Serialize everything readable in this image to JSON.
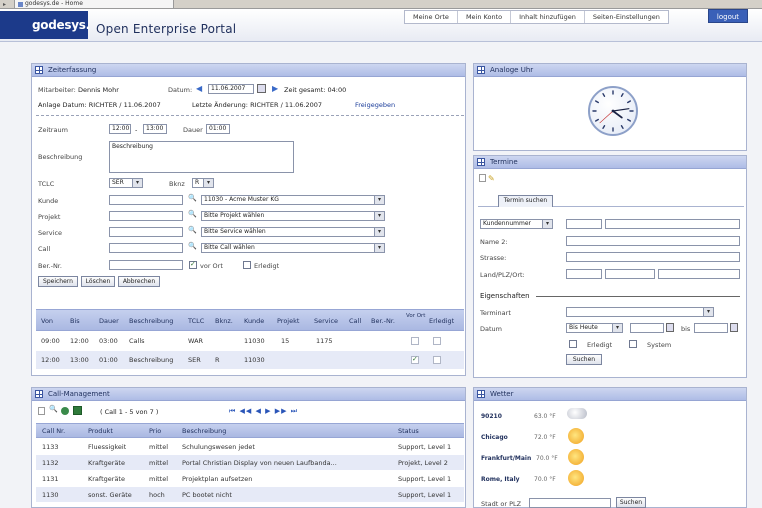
{
  "browser": {
    "tab_title": "godesys.de - Home"
  },
  "header": {
    "logo": "godesys.",
    "title": "Open Enterprise Portal",
    "nav": [
      "Meine Orte",
      "Mein Konto",
      "Inhalt hinzufügen",
      "Seiten-Einstellungen"
    ],
    "logout": "logout"
  },
  "zeit": {
    "title": "Zeiterfassung",
    "mitarbeiter_label": "Mitarbeiter:",
    "mitarbeiter": "Dennis Mohr",
    "datum_label": "Datum:",
    "datum": "11.06.2007",
    "zeit_gesamt": "Zeit gesamt: 04:00",
    "anlage": "Anlage Datum: RICHTER / 11.06.2007",
    "aenderung": "Letzte Änderung: RICHTER / 11.06.2007",
    "freigegeben": "Freigegeben",
    "zeitraum_label": "Zeitraum",
    "von": "12:00",
    "dash": "-",
    "bis": "13:00",
    "dauer_label": "Dauer",
    "dauer": "01:00",
    "beschreibung_label": "Beschreibung",
    "beschreibung": "Beschreibung",
    "tclc_label": "TCLC",
    "tclc": "SER",
    "bknz_label": "Bknz",
    "bknz": "R",
    "kunde_label": "Kunde",
    "kunde": "11030 - Acme Muster KG",
    "projekt_label": "Projekt",
    "projekt": "Bitte Projekt wählen",
    "service_label": "Service",
    "service": "Bitte Service wählen",
    "call_label": "Call",
    "call": "Bitte Call wählen",
    "bernr_label": "Ber.-Nr.",
    "vor_ort": "vor Ort",
    "erledigt": "Erledigt",
    "buttons": [
      "Speichern",
      "Löschen",
      "Abbrechen"
    ],
    "columns": [
      "Von",
      "Bis",
      "Dauer",
      "Beschreibung",
      "TCLC",
      "Bknz.",
      "Kunde",
      "Projekt",
      "Service",
      "Call",
      "Ber.-Nr.",
      "Vor Ort",
      "Erledigt"
    ],
    "rows": [
      {
        "von": "09:00",
        "bis": "12:00",
        "dauer": "03:00",
        "beschreibung": "Calls",
        "tclc": "WAR",
        "bknz": "",
        "kunde": "11030",
        "projekt": "15",
        "service": "1175",
        "call": "",
        "bernr": "",
        "vor_ort": false,
        "erledigt": false
      },
      {
        "von": "12:00",
        "bis": "13:00",
        "dauer": "01:00",
        "beschreibung": "Beschreibung",
        "tclc": "SER",
        "bknz": "R",
        "kunde": "11030",
        "projekt": "",
        "service": "",
        "call": "",
        "bernr": "",
        "vor_ort": true,
        "erledigt": false
      }
    ]
  },
  "uhr": {
    "title": "Analoge Uhr",
    "hour": 4,
    "minute": 13,
    "second": 38
  },
  "termine": {
    "title": "Termine",
    "tab": "Termin suchen",
    "field_select": "Kundennummer",
    "name2": "Name 2:",
    "strasse": "Strasse:",
    "land": "Land/PLZ/Ort:",
    "eigenschaften": "Eigenschaften",
    "terminart": "Terminart",
    "datum_label": "Datum",
    "datum_select": "Bis Heute",
    "bis": "bis",
    "erledigt": "Erledigt",
    "system": "System",
    "suchen": "Suchen"
  },
  "call": {
    "title": "Call-Management",
    "pager": "( Call 1 - 5 von 7 )",
    "nav_arrows": "⏮ ◀◀ ◀ ▶ ▶▶ ⏭",
    "columns": [
      "Call Nr.",
      "Produkt",
      "Prio",
      "Beschreibung",
      "Status"
    ],
    "rows": [
      {
        "nr": "1133",
        "produkt": "Fluessigkeit",
        "prio": "mittel",
        "beschreibung": "Schulungswesen jedet",
        "status": "Support, Level 1"
      },
      {
        "nr": "1132",
        "produkt": "Kraftgeräte",
        "prio": "mittel",
        "beschreibung": "Portal Christian Display von neuen Laufbanda...",
        "status": "Projekt, Level 2"
      },
      {
        "nr": "1131",
        "produkt": "Kraftgeräte",
        "prio": "mittel",
        "beschreibung": "Projektplan aufsetzen",
        "status": "Support, Level 1"
      },
      {
        "nr": "1130",
        "produkt": "sonst. Geräte",
        "prio": "hoch",
        "beschreibung": "PC bootet nicht",
        "status": "Support, Level 1"
      }
    ]
  },
  "wetter": {
    "title": "Wetter",
    "cities": [
      {
        "name": "90210",
        "temp": "63.0 °F"
      },
      {
        "name": "Chicago",
        "temp": "72.0 °F"
      },
      {
        "name": "Frankfurt/Main",
        "temp": "70.0 °F"
      },
      {
        "name": "Rome, Italy",
        "temp": "70.0 °F"
      }
    ],
    "search_label": "Stadt or PLZ",
    "search_button": "Suchen"
  }
}
